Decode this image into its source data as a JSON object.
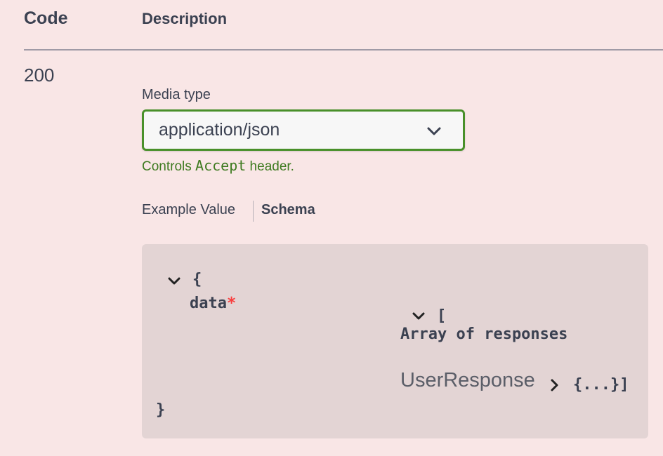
{
  "table_header": {
    "code": "Code",
    "description": "Description"
  },
  "response": {
    "code": "200",
    "media_type_label": "Media type",
    "media_type_value": "application/json",
    "controls_prefix": "Controls ",
    "controls_mono": "Accept",
    "controls_suffix": " header.",
    "tabs": {
      "example": "Example Value",
      "schema": "Schema",
      "active": "Schema"
    }
  },
  "schema": {
    "open_brace": "{",
    "property": "data",
    "required_mark": "*",
    "open_bracket": "[",
    "array_title": "Array of responses",
    "model_name": "UserResponse",
    "collapsed": "{...}]",
    "close_brace": "}"
  },
  "colors": {
    "background": "#f9e6e6",
    "select_border": "#49902a",
    "controls_text": "#3e7a20",
    "required": "#f93e3e",
    "schema_box": "#e3d4d4"
  },
  "icons": {
    "select_chevron": "chevron-down-icon",
    "expand_object": "chevron-down-icon",
    "expand_array": "chevron-down-icon",
    "expand_model": "chevron-right-icon"
  }
}
